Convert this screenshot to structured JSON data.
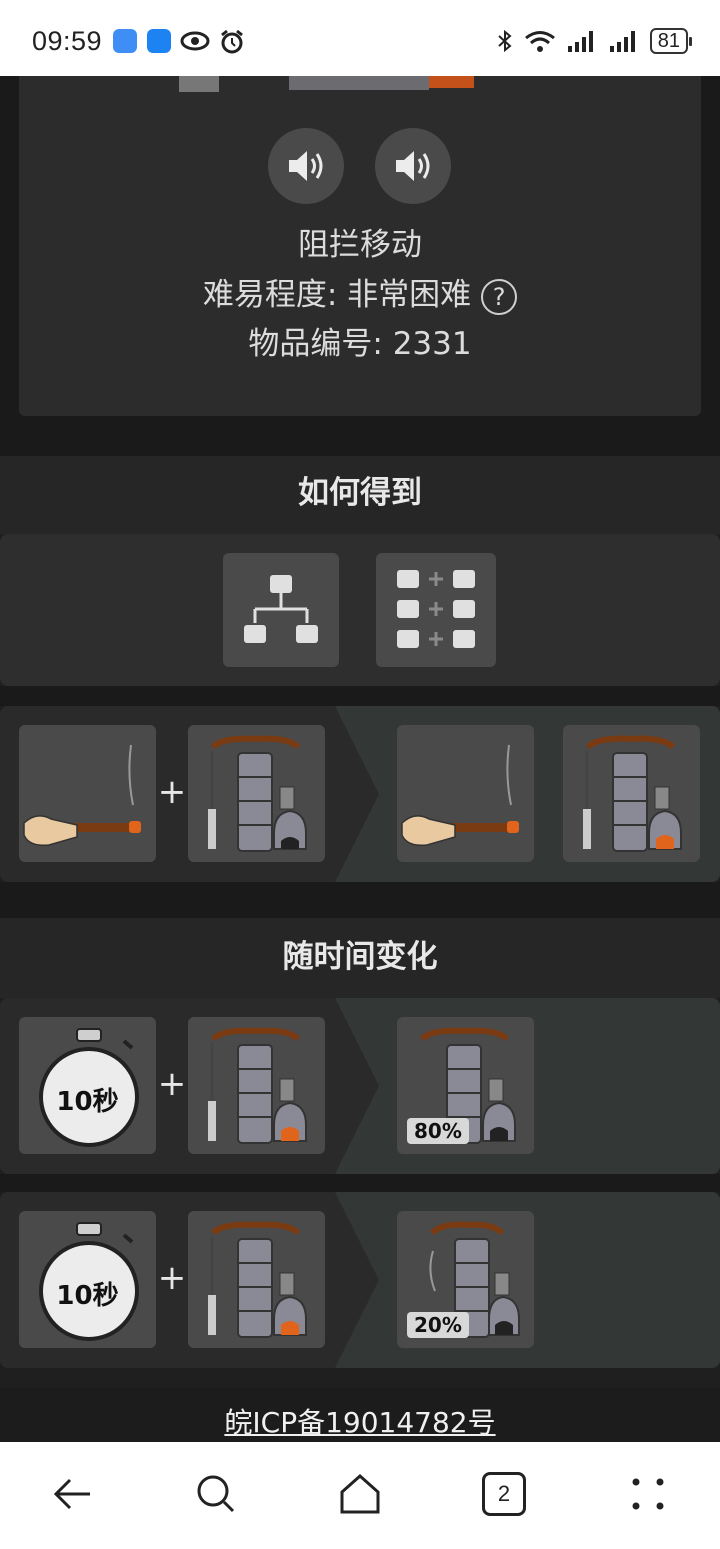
{
  "status_bar": {
    "time": "09:59",
    "icons": [
      "messages-icon",
      "app-icon",
      "eye-icon",
      "alarm-icon",
      "bluetooth-icon",
      "wifi-icon",
      "signal-icon",
      "signal-icon"
    ],
    "battery": "81"
  },
  "item": {
    "name": "阻拦移动",
    "difficulty_label": "难易程度: 非常困难",
    "help": "?",
    "id_label": "物品编号: 2331"
  },
  "sections": {
    "how_to_get": "如何得到",
    "over_time": "随时间变化"
  },
  "time_recipes": [
    {
      "timer": "10秒",
      "chance": "80%"
    },
    {
      "timer": "10秒",
      "chance": "20%"
    }
  ],
  "footer": {
    "icp": "皖ICP备19014782号"
  },
  "nav": {
    "tabs_count": "2"
  },
  "colors": {
    "background": "#1f1f1f",
    "card": "#2c2c2c",
    "slot": "#4a4a4a",
    "result_panel": "#333735"
  }
}
